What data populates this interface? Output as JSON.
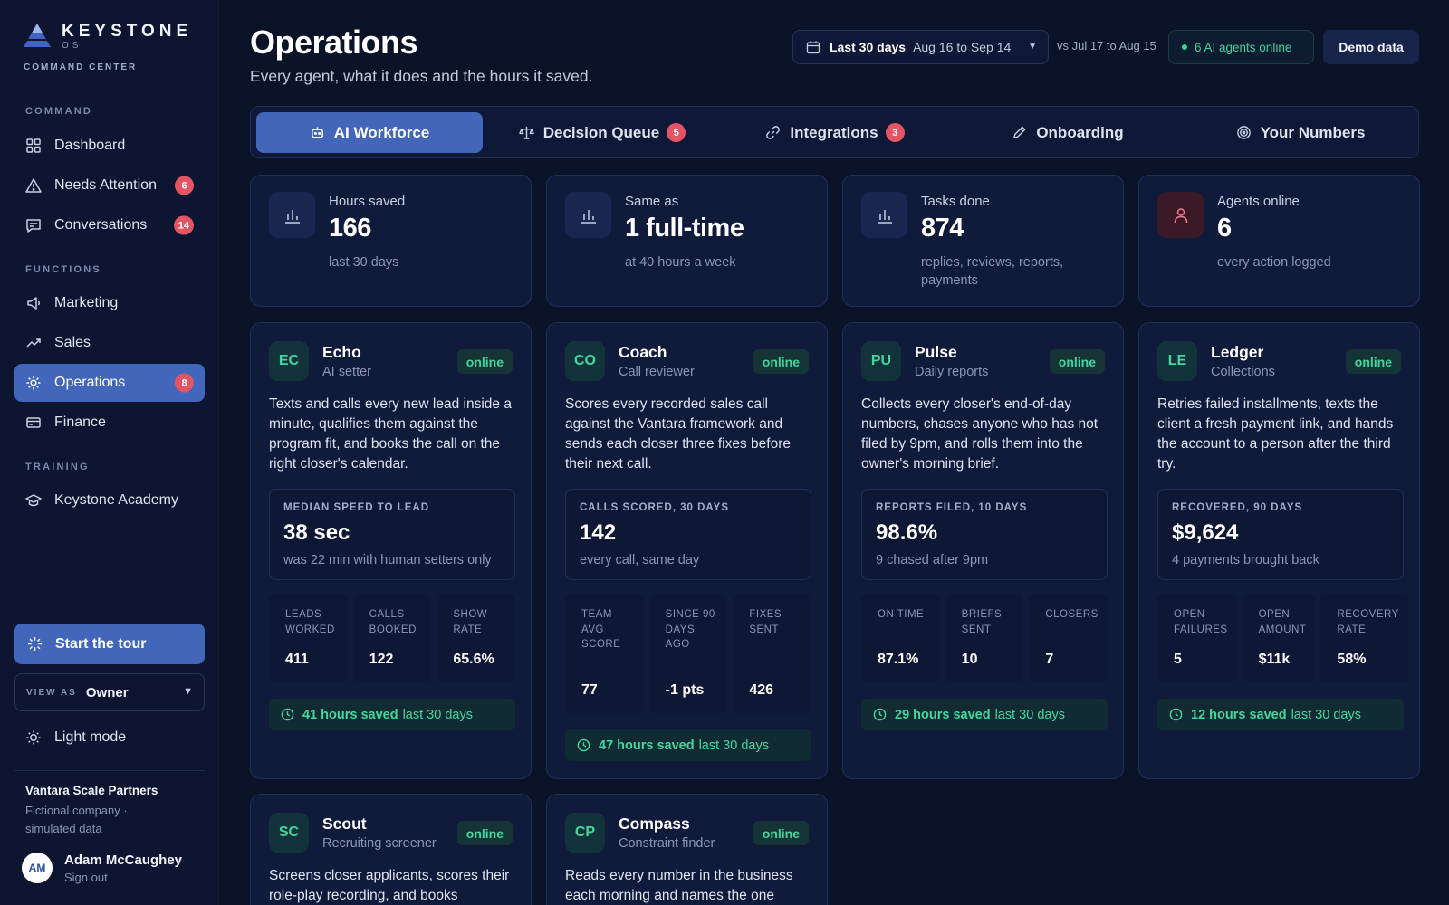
{
  "brand": {
    "name": "KEYSTONE",
    "os": "OS",
    "subtitle": "COMMAND CENTER"
  },
  "sidebar": {
    "sections": {
      "command": "COMMAND",
      "functions": "FUNCTIONS",
      "training": "TRAINING"
    },
    "items": [
      {
        "label": "Dashboard",
        "icon": "grid-icon"
      },
      {
        "label": "Needs Attention",
        "icon": "warning-icon",
        "badge": "6"
      },
      {
        "label": "Conversations",
        "icon": "chat-icon",
        "badge": "14"
      },
      {
        "label": "Marketing",
        "icon": "megaphone-icon"
      },
      {
        "label": "Sales",
        "icon": "trend-icon"
      },
      {
        "label": "Operations",
        "icon": "gear-icon",
        "badge": "8",
        "active": true
      },
      {
        "label": "Finance",
        "icon": "card-icon"
      },
      {
        "label": "Keystone Academy",
        "icon": "graduation-cap-icon"
      }
    ],
    "tour_label": "Start the tour",
    "view_as": {
      "label": "VIEW AS",
      "value": "Owner"
    },
    "light_mode_label": "Light mode",
    "org": {
      "name": "Vantara Scale Partners",
      "subtitle": "Fictional company · simulated data"
    },
    "user": {
      "initials": "AM",
      "name": "Adam McCaughey",
      "action": "Sign out"
    }
  },
  "header": {
    "title": "Operations",
    "subtitle": "Every agent, what it does and the hours it saved.",
    "range": {
      "label": "Last 30 days",
      "dates": "Aug 16 to Sep 14"
    },
    "compare": "vs Jul 17 to Aug 15",
    "agents_online": "6 AI agents online",
    "demo_label": "Demo data"
  },
  "tabs": [
    {
      "label": "AI Workforce",
      "icon": "robot-icon",
      "active": true
    },
    {
      "label": "Decision Queue",
      "icon": "scale-icon",
      "badge": "5"
    },
    {
      "label": "Integrations",
      "icon": "link-icon",
      "badge": "3"
    },
    {
      "label": "Onboarding",
      "icon": "pencil-icon"
    },
    {
      "label": "Your Numbers",
      "icon": "target-icon"
    }
  ],
  "stats": [
    {
      "label": "Hours saved",
      "value": "166",
      "sub": "last 30 days",
      "icon": "bar-chart-icon"
    },
    {
      "label": "Same as",
      "value": "1 full-time",
      "sub": "at 40 hours a week",
      "icon": "bar-chart-icon"
    },
    {
      "label": "Tasks done",
      "value": "874",
      "sub": "replies, reviews, reports, payments",
      "icon": "bar-chart-icon"
    },
    {
      "label": "Agents online",
      "value": "6",
      "sub": "every action logged",
      "icon": "person-icon"
    }
  ],
  "agents": [
    {
      "initials": "EC",
      "name": "Echo",
      "role": "AI setter",
      "status": "online",
      "desc": "Texts and calls every new lead inside a minute, qualifies them against the program fit, and books the call on the right closer's calendar.",
      "metric": {
        "label": "MEDIAN SPEED TO LEAD",
        "value": "38 sec",
        "sub": "was 22 min with human setters only"
      },
      "minis": [
        {
          "label": "LEADS WORKED",
          "value": "411"
        },
        {
          "label": "CALLS BOOKED",
          "value": "122"
        },
        {
          "label": "SHOW RATE",
          "value": "65.6%"
        }
      ],
      "saved": {
        "bold": "41 hours saved",
        "rest": "last 30 days"
      }
    },
    {
      "initials": "CO",
      "name": "Coach",
      "role": "Call reviewer",
      "status": "online",
      "desc": "Scores every recorded sales call against the Vantara framework and sends each closer three fixes before their next call.",
      "metric": {
        "label": "CALLS SCORED, 30 DAYS",
        "value": "142",
        "sub": "every call, same day"
      },
      "minis": [
        {
          "label": "TEAM AVG SCORE",
          "value": "77"
        },
        {
          "label": "SINCE 90 DAYS AGO",
          "value": "-1 pts"
        },
        {
          "label": "FIXES SENT",
          "value": "426"
        }
      ],
      "saved": {
        "bold": "47 hours saved",
        "rest": "last 30 days"
      }
    },
    {
      "initials": "PU",
      "name": "Pulse",
      "role": "Daily reports",
      "status": "online",
      "desc": "Collects every closer's end-of-day numbers, chases anyone who has not filed by 9pm, and rolls them into the owner's morning brief.",
      "metric": {
        "label": "REPORTS FILED, 10 DAYS",
        "value": "98.6%",
        "sub": "9 chased after 9pm"
      },
      "minis": [
        {
          "label": "ON TIME",
          "value": "87.1%"
        },
        {
          "label": "BRIEFS SENT",
          "value": "10"
        },
        {
          "label": "CLOSERS",
          "value": "7"
        }
      ],
      "saved": {
        "bold": "29 hours saved",
        "rest": "last 30 days"
      }
    },
    {
      "initials": "LE",
      "name": "Ledger",
      "role": "Collections",
      "status": "online",
      "desc": "Retries failed installments, texts the client a fresh payment link, and hands the account to a person after the third try.",
      "metric": {
        "label": "RECOVERED, 90 DAYS",
        "value": "$9,624",
        "sub": "4 payments brought back"
      },
      "minis": [
        {
          "label": "OPEN FAILURES",
          "value": "5"
        },
        {
          "label": "OPEN AMOUNT",
          "value": "$11k"
        },
        {
          "label": "RECOVERY RATE",
          "value": "58%"
        }
      ],
      "saved": {
        "bold": "12 hours saved",
        "rest": "last 30 days"
      }
    },
    {
      "initials": "SC",
      "name": "Scout",
      "role": "Recruiting screener",
      "status": "online",
      "desc": "Screens closer applicants, scores their role-play recording, and books"
    },
    {
      "initials": "CP",
      "name": "Compass",
      "role": "Constraint finder",
      "status": "online",
      "desc": "Reads every number in the business each morning and names the one"
    }
  ]
}
